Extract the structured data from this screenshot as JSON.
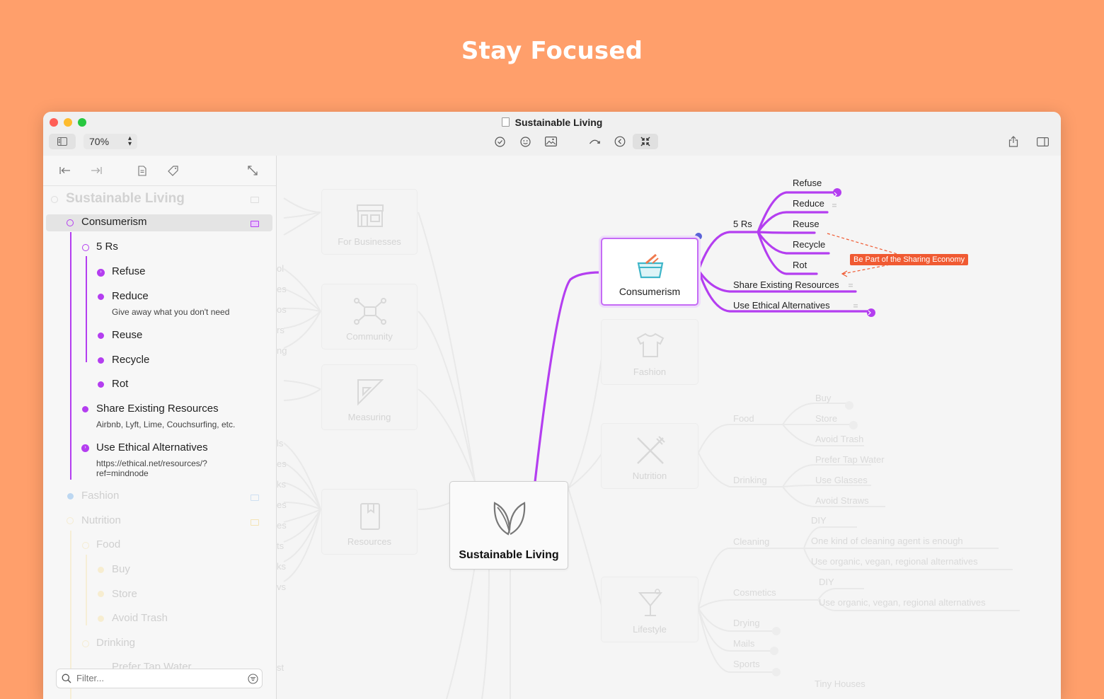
{
  "headline": "Stay Focused",
  "window": {
    "title": "Sustainable Living"
  },
  "toolbar": {
    "zoom": "70%"
  },
  "colors": {
    "accent": "#b43ef0",
    "annotation": "#f05a32",
    "background": "#FF9F6B"
  },
  "sidebar": {
    "root": "Sustainable Living",
    "consumerism": "Consumerism",
    "five_rs": "5 Rs",
    "refuse": "Refuse",
    "reduce": "Reduce",
    "reduce_note": "Give away what you don't need",
    "reuse": "Reuse",
    "recycle": "Recycle",
    "rot": "Rot",
    "share": "Share Existing Resources",
    "share_note": "Airbnb, Lyft, Lime, Couchsurfing, etc.",
    "ethical": "Use Ethical Alternatives",
    "ethical_note": "https://ethical.net/resources/?\nref=mindnode",
    "fashion": "Fashion",
    "nutrition": "Nutrition",
    "food": "Food",
    "buy": "Buy",
    "store": "Store",
    "avoid_trash": "Avoid Trash",
    "drinking": "Drinking",
    "prefer_tap": "Prefer Tap Water",
    "filter_placeholder": "Filter..."
  },
  "map": {
    "root": "Sustainable Living",
    "for_businesses": "For Businesses",
    "community": "Community",
    "measuring": "Measuring",
    "resources": "Resources",
    "consumerism": "Consumerism",
    "fashion": "Fashion",
    "nutrition": "Nutrition",
    "lifestyle": "Lifestyle",
    "five_rs": "5 Rs",
    "refuse": "Refuse",
    "reduce": "Reduce",
    "reuse": "Reuse",
    "recycle": "Recycle",
    "rot": "Rot",
    "share": "Share Existing Resources",
    "ethical": "Use Ethical Alternatives",
    "annotation": "Be Part of the Sharing Economy",
    "food": "Food",
    "drinking": "Drinking",
    "buy": "Buy",
    "store": "Store",
    "avoid_trash": "Avoid Trash",
    "prefer_tap": "Prefer Tap Water",
    "use_glasses": "Use Glasses",
    "avoid_straws": "Avoid Straws",
    "cleaning": "Cleaning",
    "diy": "DIY",
    "one_kind": "One kind of cleaning agent is enough",
    "use_organic": "Use organic, vegan, regional alternatives",
    "cosmetics": "Cosmetics",
    "diy2": "DIY",
    "use_organic2": "Use organic, vegan, regional alternatives",
    "drying": "Drying",
    "mails": "Mails",
    "sports": "Sports",
    "tiny_houses": "Tiny Houses",
    "left_frag_1": "ol",
    "left_frag_2": "es",
    "left_frag_3": "os",
    "left_frag_4": "rs",
    "left_frag_5": "ng",
    "left_frag_6": "ls",
    "left_frag_7": "es",
    "left_frag_8": "ks",
    "left_frag_9": "es",
    "left_frag_10": "es",
    "left_frag_11": "ts",
    "left_frag_12": "ks",
    "left_frag_13": "vs",
    "left_frag_14": "st"
  }
}
